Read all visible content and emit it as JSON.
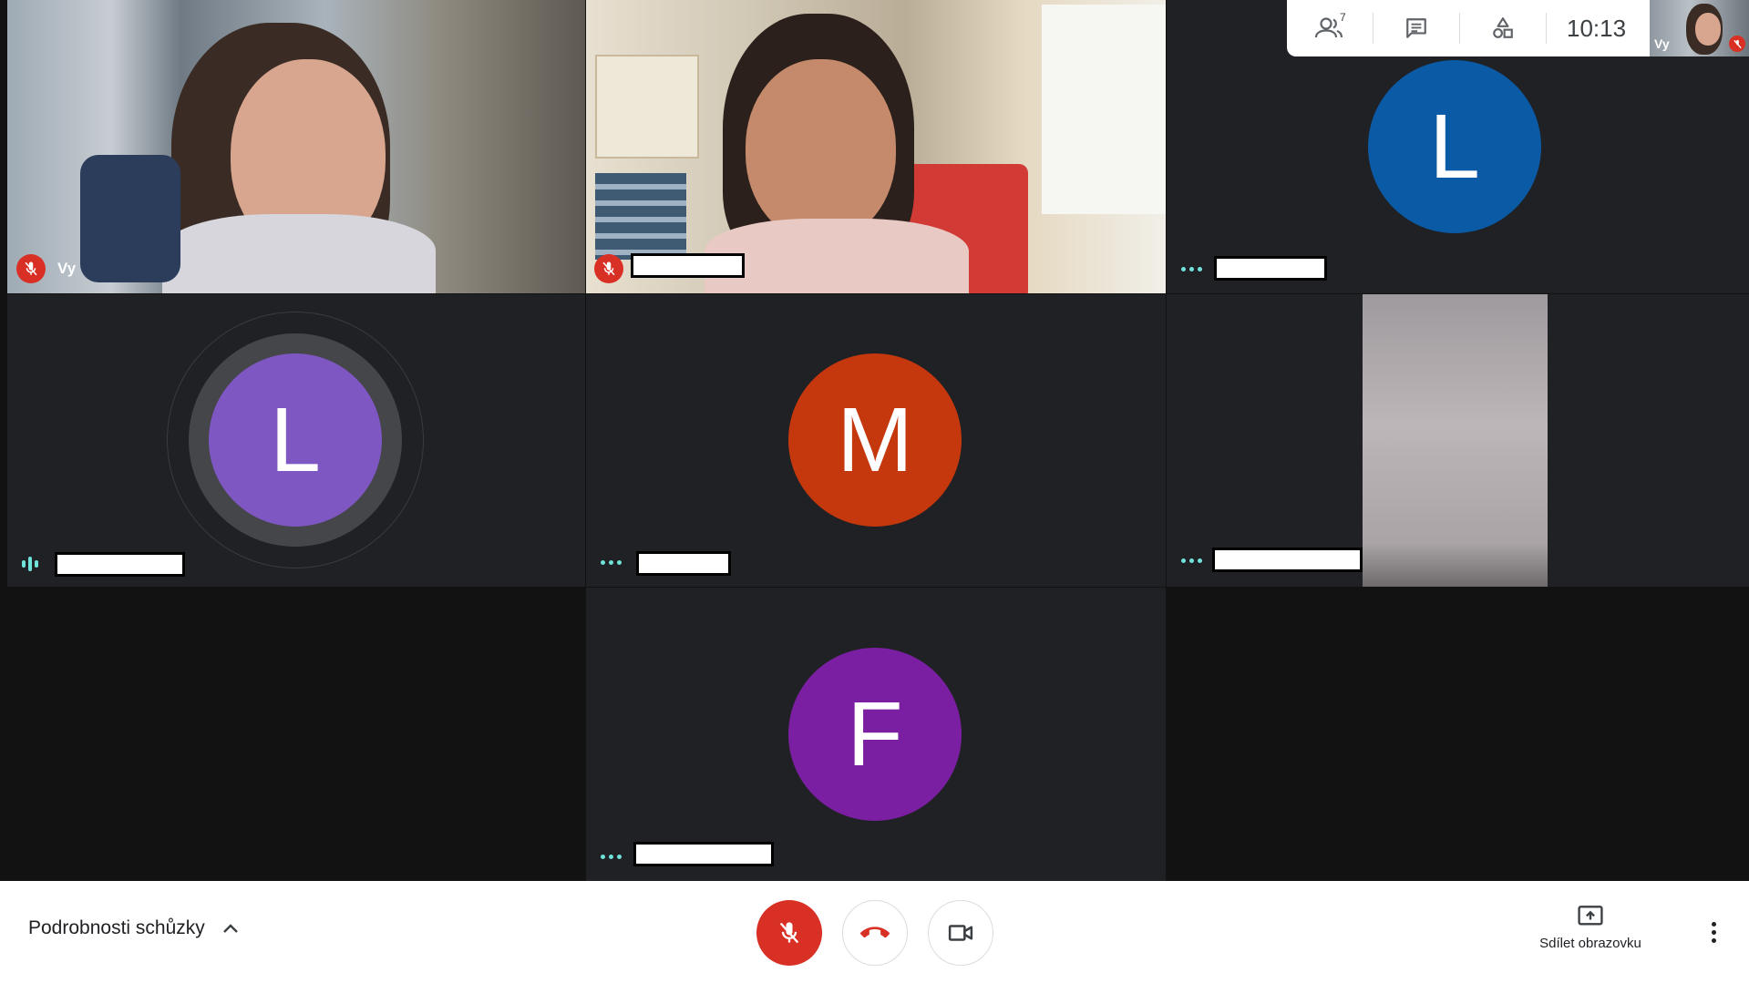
{
  "tiles": {
    "self": {
      "name": "Vy"
    },
    "participant_l_blue": {
      "initial": "L",
      "color": "#0b5aa6"
    },
    "participant_l_purple": {
      "initial": "L",
      "color": "#7e57c2"
    },
    "participant_m": {
      "initial": "M",
      "color": "#c5380e"
    },
    "participant_f": {
      "initial": "F",
      "color": "#7b1fa2"
    }
  },
  "topbar": {
    "participants_icon": "people-icon",
    "participant_count": "7",
    "chat_icon": "chat-icon",
    "activities_icon": "shapes-icon",
    "clock": "10:13"
  },
  "selfview": {
    "label": "Vy"
  },
  "bottombar": {
    "details_label": "Podrobnosti schůzky",
    "mic_icon": "mic-off-icon",
    "hangup_icon": "hang-up-icon",
    "camera_icon": "video-camera-icon",
    "share_label": "Sdílet obrazovku",
    "share_icon": "present-screen-icon",
    "more_icon": "more-vertical-icon"
  },
  "colors": {
    "tile_bg": "#202124",
    "stage_bg": "#121212",
    "mic_off_red": "#d93025",
    "activity_teal": "#6fe3d9"
  }
}
